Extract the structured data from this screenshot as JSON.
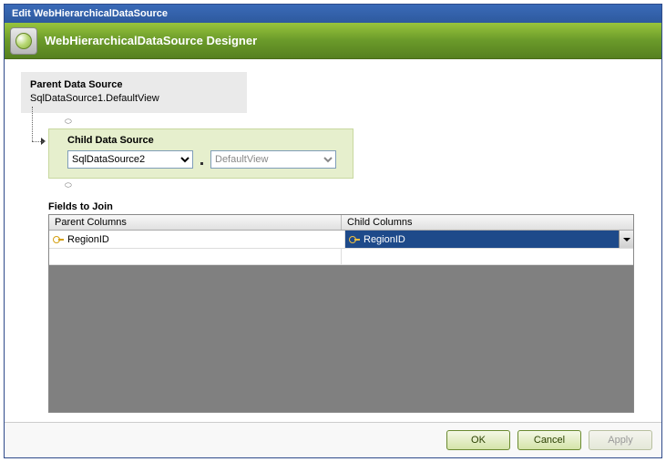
{
  "window": {
    "title": "Edit WebHierarchicalDataSource"
  },
  "designer": {
    "title": "WebHierarchicalDataSource Designer"
  },
  "parent": {
    "header": "Parent Data Source",
    "value": "SqlDataSource1.DefaultView"
  },
  "child": {
    "header": "Child Data Source",
    "source_selected": "SqlDataSource2",
    "view_selected": "DefaultView"
  },
  "fields": {
    "header": "Fields to Join",
    "columns": {
      "parent": "Parent Columns",
      "child": "Child Columns"
    },
    "rows": [
      {
        "parent": "RegionID",
        "child": "RegionID"
      }
    ]
  },
  "buttons": {
    "ok": "OK",
    "cancel": "Cancel",
    "apply": "Apply"
  }
}
